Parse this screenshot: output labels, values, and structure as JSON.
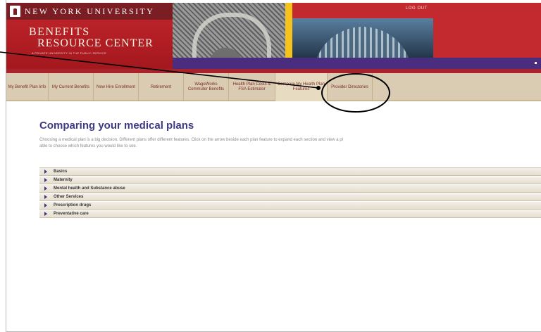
{
  "header": {
    "university": "NEW YORK UNIVERSITY",
    "title_line1": "BENEFITS",
    "title_line2": "RESOURCE CENTER",
    "tagline": "A PRIVATE UNIVERSITY IN THE PUBLIC SERVICE",
    "logout": "LOG OUT"
  },
  "nav": {
    "items": [
      {
        "label": "My Benefit Plan Info"
      },
      {
        "label": "My Current Benefits"
      },
      {
        "label": "New Hire Enrollment"
      },
      {
        "label": "Retirement"
      },
      {
        "label": "WageWorks Commuter Benefits"
      },
      {
        "label": "Health Plan Costs & FSA Estimator"
      },
      {
        "label": "Compare My Health Plan Features"
      },
      {
        "label": "Provider Directories"
      }
    ]
  },
  "main": {
    "title": "Comparing your medical plans",
    "intro_line1": "Choosing a medical plan is a big decision. Different plans offer different features. Click on the arrow beside each plan feature to expand each section and view a pl",
    "intro_line2": "able to choose which features you would like to see.",
    "sections": [
      {
        "label": "Basics"
      },
      {
        "label": "Maternity"
      },
      {
        "label": "Mental health and Substance abuse"
      },
      {
        "label": "Other Services"
      },
      {
        "label": "Prescription drugs"
      },
      {
        "label": "Preventative care"
      }
    ]
  },
  "colors": {
    "brand_red": "#c32a30",
    "nav_bg": "#d9ccb2",
    "title_blue": "#3b3a83",
    "accent_purple": "#4b2d7f"
  }
}
